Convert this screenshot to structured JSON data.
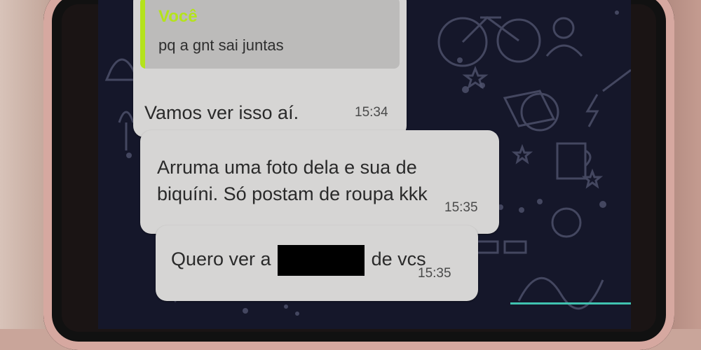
{
  "chat": {
    "messages": [
      {
        "quote": {
          "author": "Você",
          "text": "pq a gnt sai juntas"
        },
        "text": "Vamos ver isso aí.",
        "time": "15:34"
      },
      {
        "line1": "Arruma uma foto dela e sua de",
        "line2": "biquíni. Só postam de roupa kkk",
        "time": "15:35"
      },
      {
        "before": "Quero ver a",
        "after": "de vcs",
        "time": "15:35"
      }
    ]
  },
  "colors": {
    "bubble": "#d6d5d4",
    "wallpaper": "#15172a",
    "quote_accent": "#b4e31c"
  }
}
